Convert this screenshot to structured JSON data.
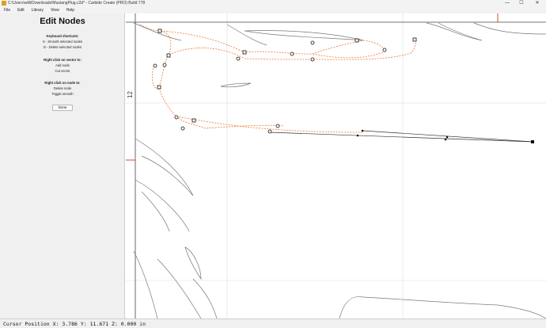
{
  "window": {
    "title": "C:\\Users\\willi\\Downloads\\MustangPlug.c2d* - Carbide Create (PRO) Build 778",
    "min_glyph": "—",
    "max_glyph": "☐",
    "close_glyph": "✕"
  },
  "menu": [
    "File",
    "Edit",
    "Library",
    "View",
    "Help"
  ],
  "panel": {
    "title": "Edit Nodes",
    "shortcuts_heading": "Keyboard shortcuts:",
    "shortcut_1": "S - Smooth selected nodes",
    "shortcut_2": "D - Delete selected nodes",
    "vector_heading": "Right click on vector to:",
    "vector_1": "Add node",
    "vector_2": "Cut vector",
    "node_heading": "Right click on node to:",
    "node_1": "Delete node",
    "node_2": "Toggle smooth",
    "done_label": "Done"
  },
  "canvas": {
    "ruler_label": "12",
    "colors": {
      "selected_path": "#f07a30",
      "vector": "#777777",
      "grid": "#dcdcdc",
      "axis": "#c8502a",
      "node": "#111111"
    }
  },
  "status": {
    "text": "Cursor Position X: 3.786 Y: 11.671 Z: 0.000 in"
  }
}
